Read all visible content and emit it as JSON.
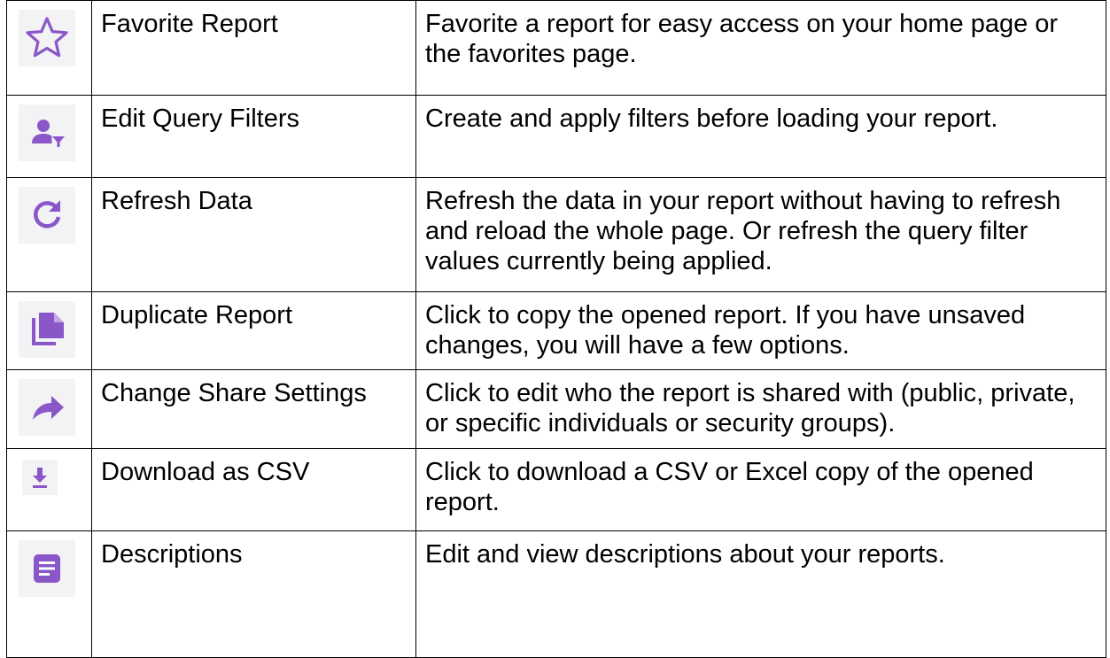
{
  "accent_color": "#8a57c8",
  "rows": [
    {
      "icon": "star-outline-icon",
      "name": "Favorite Report",
      "description": "Favorite a report for easy access on your home page or the favorites page."
    },
    {
      "icon": "person-filter-icon",
      "name": "Edit Query Filters",
      "description": "Create and apply filters before loading your report."
    },
    {
      "icon": "refresh-icon",
      "name": "Refresh Data",
      "description": "Refresh the data in your report without having to refresh and reload the whole page. Or refresh the query filter values currently being applied."
    },
    {
      "icon": "copy-file-icon",
      "name": "Duplicate Report",
      "description": "Click to copy the opened report. If you have unsaved changes, you will have a few options."
    },
    {
      "icon": "share-arrow-icon",
      "name": "Change Share Settings",
      "description": "Click to edit who the report is shared with (public, private, or specific individuals or security groups)."
    },
    {
      "icon": "download-icon",
      "name": "Download as CSV",
      "description": "Click to download a CSV or Excel copy of the opened report."
    },
    {
      "icon": "description-icon",
      "name": "Descriptions",
      "description": "Edit and view descriptions about your reports."
    }
  ]
}
